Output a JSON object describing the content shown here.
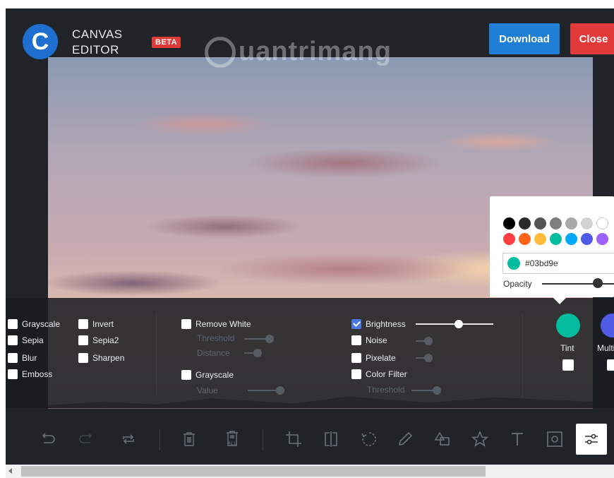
{
  "header": {
    "logo_letter": "C",
    "app_title": "CANVAS EDITOR",
    "beta_badge": "BETA",
    "download_label": "Download",
    "close_label": "Close",
    "watermark": "uantrimang"
  },
  "filters": {
    "group1": [
      {
        "label": "Grayscale",
        "checked": false
      },
      {
        "label": "Sepia",
        "checked": false
      },
      {
        "label": "Blur",
        "checked": false
      },
      {
        "label": "Emboss",
        "checked": false
      }
    ],
    "group2": [
      {
        "label": "Invert",
        "checked": false
      },
      {
        "label": "Sepia2",
        "checked": false
      },
      {
        "label": "Sharpen",
        "checked": false
      }
    ],
    "remove_white": {
      "label": "Remove White",
      "checked": false,
      "threshold_label": "Threshold",
      "distance_label": "Distance"
    },
    "grayscale2": {
      "label": "Grayscale",
      "checked": false,
      "value_label": "Value"
    },
    "brightness": {
      "label": "Brightness",
      "checked": true
    },
    "noise": {
      "label": "Noise",
      "checked": false
    },
    "pixelate": {
      "label": "Pixelate",
      "checked": false
    },
    "color_filter": {
      "label": "Color Filter",
      "checked": false,
      "threshold_label": "Threshold"
    },
    "tint": {
      "label": "Tint",
      "color": "#03bd9e",
      "checked": false
    },
    "multiply": {
      "label": "Multi",
      "color": "#515ce6",
      "checked": false
    }
  },
  "color_picker": {
    "row1": [
      "#000000",
      "#2a2a2a",
      "#545454",
      "#7e7e7e",
      "#a8a8a8",
      "#d2d2d2",
      "#ffffff"
    ],
    "row2": [
      "#ff4040",
      "#ff6518",
      "#ffbb3b",
      "#03bd9e",
      "#00a9ff",
      "#515ce6",
      "#9e5fff"
    ],
    "hex_value": "#03bd9e",
    "opacity_label": "Opacity",
    "opacity": 0.85
  },
  "toolbar": {
    "tools": [
      "undo-icon",
      "redo-icon",
      "reset-icon",
      "delete-icon",
      "delete-all-icon",
      "crop-icon",
      "flip-icon",
      "rotate-icon",
      "draw-icon",
      "shape-icon",
      "icon-star",
      "text-icon",
      "mask-icon",
      "filter-icon"
    ],
    "delete_all_text": "ALL"
  }
}
